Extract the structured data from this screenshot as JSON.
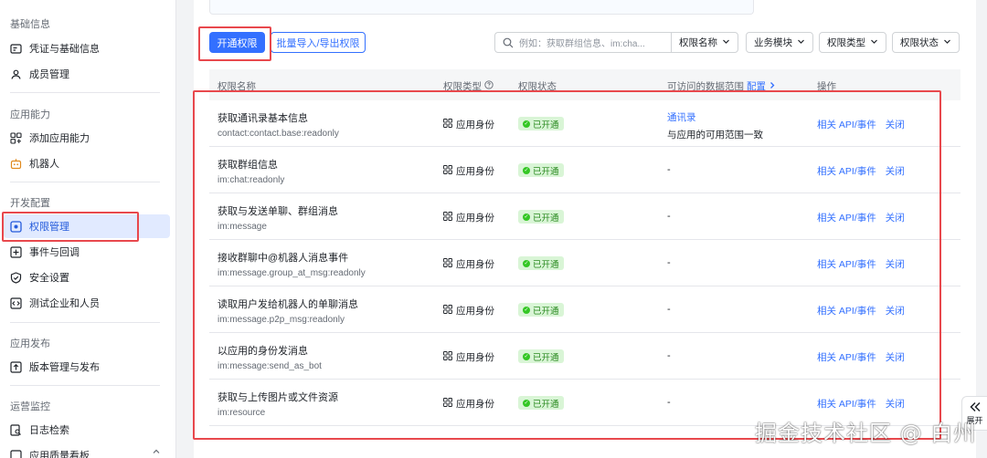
{
  "sidebar": {
    "sections": [
      {
        "title": "基础信息",
        "items": [
          {
            "label": "凭证与基础信息",
            "icon": "credential-card-icon"
          },
          {
            "label": "成员管理",
            "icon": "members-icon"
          }
        ]
      },
      {
        "title": "应用能力",
        "items": [
          {
            "label": "添加应用能力",
            "icon": "add-capability-icon"
          },
          {
            "label": "机器人",
            "icon": "robot-icon"
          }
        ]
      },
      {
        "title": "开发配置",
        "items": [
          {
            "label": "权限管理",
            "icon": "permission-icon",
            "active": true
          },
          {
            "label": "事件与回调",
            "icon": "event-callback-icon"
          },
          {
            "label": "安全设置",
            "icon": "shield-icon"
          },
          {
            "label": "测试企业和人员",
            "icon": "test-code-icon"
          }
        ]
      },
      {
        "title": "应用发布",
        "items": [
          {
            "label": "版本管理与发布",
            "icon": "publish-upload-icon"
          }
        ]
      },
      {
        "title": "运营监控",
        "items": [
          {
            "label": "日志检索",
            "icon": "log-search-icon"
          },
          {
            "label": "应用质量看板",
            "icon": "quality-board-icon"
          }
        ]
      }
    ]
  },
  "toolbar": {
    "primary_label": "开通权限",
    "batch_label": "批量导入/导出权限",
    "search_placeholder": "例如：获取群组信息、im:cha...",
    "filters": [
      "权限名称",
      "业务模块",
      "权限类型",
      "权限状态"
    ]
  },
  "table": {
    "headers": {
      "name": "权限名称",
      "type": "权限类型",
      "status": "权限状态",
      "scope": "可访问的数据范围",
      "scope_link": "配置",
      "ops": "操作"
    },
    "rows": [
      {
        "name": "获取通讯录基本信息",
        "code": "contact:contact.base:readonly",
        "type": "应用身份",
        "status": "已开通",
        "scope_link": "通讯录",
        "scope_text": "与应用的可用范围一致",
        "op1": "相关 API/事件",
        "op2": "关闭"
      },
      {
        "name": "获取群组信息",
        "code": "im:chat:readonly",
        "type": "应用身份",
        "status": "已开通",
        "scope_text": "-",
        "op1": "相关 API/事件",
        "op2": "关闭"
      },
      {
        "name": "获取与发送单聊、群组消息",
        "code": "im:message",
        "type": "应用身份",
        "status": "已开通",
        "scope_text": "-",
        "op1": "相关 API/事件",
        "op2": "关闭"
      },
      {
        "name": "接收群聊中@机器人消息事件",
        "code": "im:message.group_at_msg:readonly",
        "type": "应用身份",
        "status": "已开通",
        "scope_text": "-",
        "op1": "相关 API/事件",
        "op2": "关闭"
      },
      {
        "name": "读取用户发给机器人的单聊消息",
        "code": "im:message.p2p_msg:readonly",
        "type": "应用身份",
        "status": "已开通",
        "scope_text": "-",
        "op1": "相关 API/事件",
        "op2": "关闭"
      },
      {
        "name": "以应用的身份发消息",
        "code": "im:message:send_as_bot",
        "type": "应用身份",
        "status": "已开通",
        "scope_text": "-",
        "op1": "相关 API/事件",
        "op2": "关闭"
      },
      {
        "name": "获取与上传图片或文件资源",
        "code": "im:resource",
        "type": "应用身份",
        "status": "已开通",
        "scope_text": "-",
        "op1": "相关 API/事件",
        "op2": "关闭"
      }
    ]
  },
  "float": {
    "expand_label": "展开"
  },
  "watermark": "掘金技术社区 @ 白州",
  "colors": {
    "primary": "#3370ff",
    "highlight": "#e8484d",
    "status_green": "#2a8a20"
  }
}
